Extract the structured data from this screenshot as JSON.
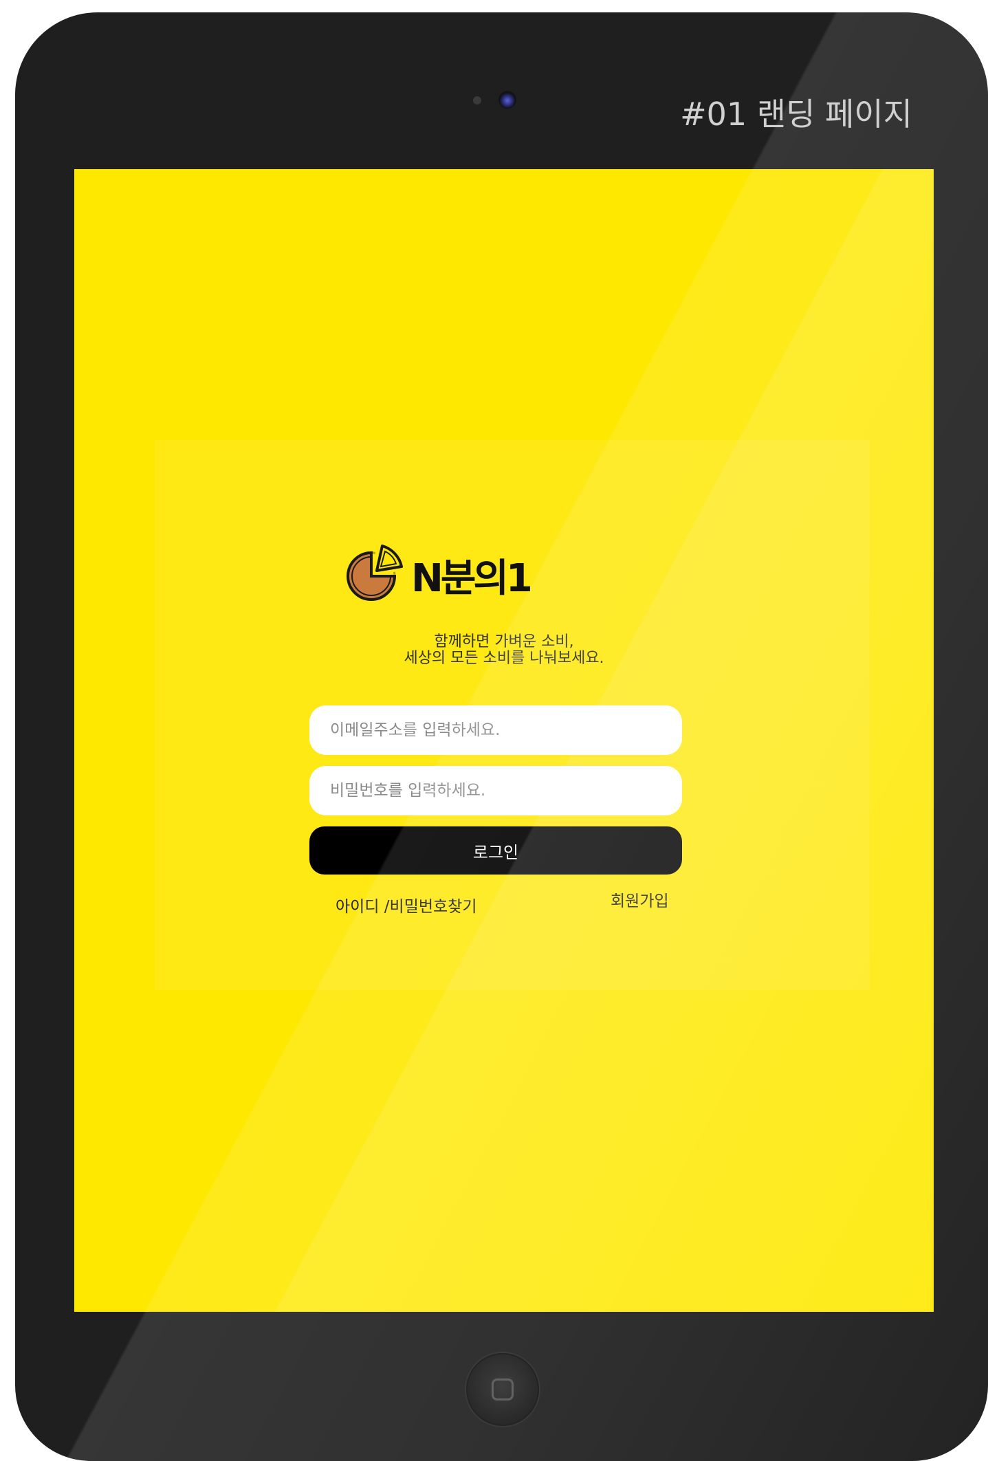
{
  "page_label": "#01 랜딩 페이지",
  "app": {
    "brand_name": "N분의1",
    "tagline_line1": "함께하면 가벼운 소비,",
    "tagline_line2": "세상의 모든 소비를 나눠보세요."
  },
  "login_form": {
    "email_placeholder": "이메일주소를 입력하세요.",
    "email_value": "",
    "password_placeholder": "비밀번호를 입력하세요.",
    "password_value": "",
    "login_label": "로그인",
    "find_account_label": "아이디 /비밀번호찾기",
    "signup_label": "회원가입"
  },
  "colors": {
    "screen_background": "#fee800",
    "device_frame": "#1f1f1f",
    "button_background": "#000000",
    "logo_pie": "#c97a3c"
  },
  "icons": {
    "logo": "pie-slice-icon",
    "home": "home-button-icon",
    "camera": "camera-icon"
  }
}
